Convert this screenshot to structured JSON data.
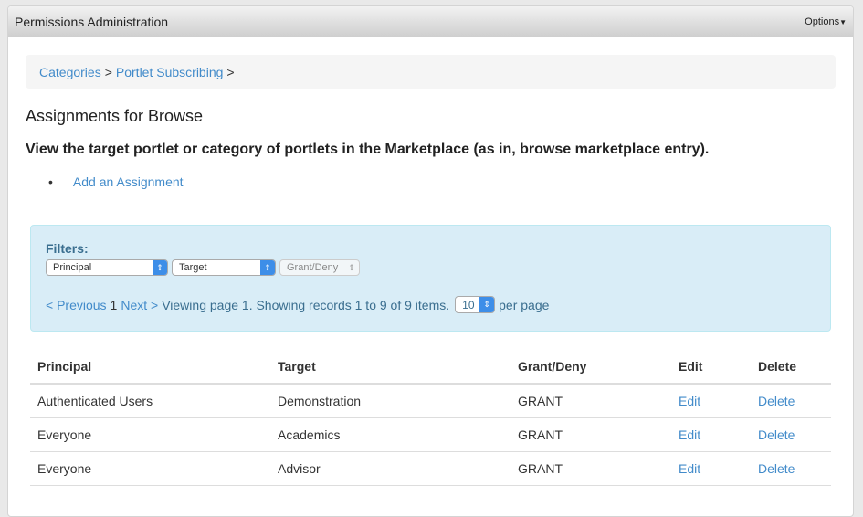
{
  "header": {
    "title": "Permissions Administration",
    "options_label": "Options"
  },
  "breadcrumb": {
    "items": [
      "Categories",
      "Portlet Subscribing"
    ],
    "sep": ">"
  },
  "heading": "Assignments for Browse",
  "description": "View the target portlet or category of portlets in the Marketplace (as in, browse marketplace entry).",
  "actions": {
    "bullet": "•",
    "add": "Add an Assignment"
  },
  "filters": {
    "label": "Filters:",
    "principal": "Principal",
    "target": "Target",
    "grant_deny": "Grant/Deny"
  },
  "pager": {
    "previous": "< Previous",
    "current": "1",
    "next": "Next >",
    "summary": "Viewing page 1. Showing records 1 to 9 of 9 items.",
    "per_page_value": "10",
    "per_page_label": "per page"
  },
  "table": {
    "headers": [
      "Principal",
      "Target",
      "Grant/Deny",
      "Edit",
      "Delete"
    ],
    "rows": [
      {
        "principal": "Authenticated Users",
        "target": "Demonstration",
        "grant": "GRANT",
        "edit": "Edit",
        "delete": "Delete"
      },
      {
        "principal": "Everyone",
        "target": "Academics",
        "grant": "GRANT",
        "edit": "Edit",
        "delete": "Delete"
      },
      {
        "principal": "Everyone",
        "target": "Advisor",
        "grant": "GRANT",
        "edit": "Edit",
        "delete": "Delete"
      }
    ]
  }
}
